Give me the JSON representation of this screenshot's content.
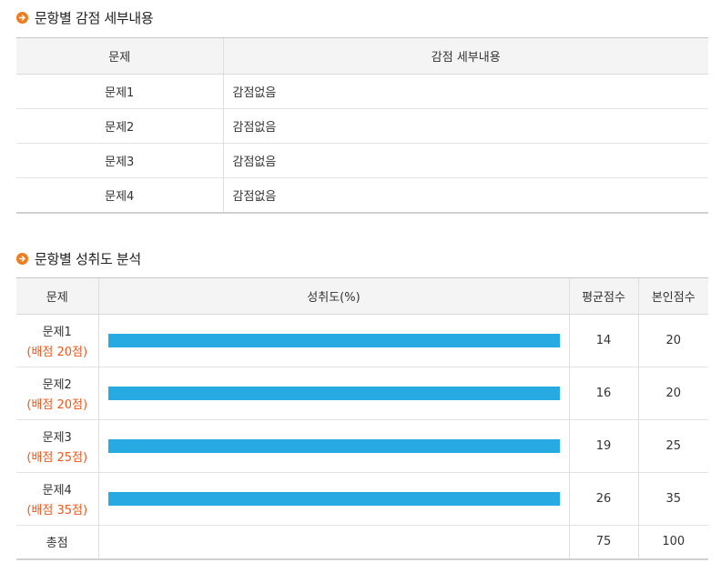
{
  "section1": {
    "title": "문항별 감점 세부내용",
    "headers": {
      "question": "문제",
      "detail": "감점 세부내용"
    },
    "rows": [
      {
        "question": "문제1",
        "detail": "감점없음"
      },
      {
        "question": "문제2",
        "detail": "감점없음"
      },
      {
        "question": "문제3",
        "detail": "감점없음"
      },
      {
        "question": "문제4",
        "detail": "감점없음"
      }
    ]
  },
  "section2": {
    "title": "문항별 성취도 분석",
    "headers": {
      "question": "문제",
      "achievement": "성취도(%)",
      "avg": "평균점수",
      "mine": "본인점수"
    },
    "rows": [
      {
        "question": "문제1",
        "allocation": "(배점 20점)",
        "achievement": 100,
        "avg": "14",
        "mine": "20"
      },
      {
        "question": "문제2",
        "allocation": "(배점 20점)",
        "achievement": 100,
        "avg": "16",
        "mine": "20"
      },
      {
        "question": "문제3",
        "allocation": "(배점 25점)",
        "achievement": 100,
        "avg": "19",
        "mine": "25"
      },
      {
        "question": "문제4",
        "allocation": "(배점 35점)",
        "achievement": 100,
        "avg": "26",
        "mine": "35"
      }
    ],
    "total": {
      "label": "총점",
      "avg": "75",
      "mine": "100"
    }
  },
  "colors": {
    "accent": "#ee7d1d",
    "allocation": "#ea5a1f",
    "bar": "#27a9e1"
  },
  "icons": {
    "section_bullet": "arrow-right-circle-icon"
  }
}
